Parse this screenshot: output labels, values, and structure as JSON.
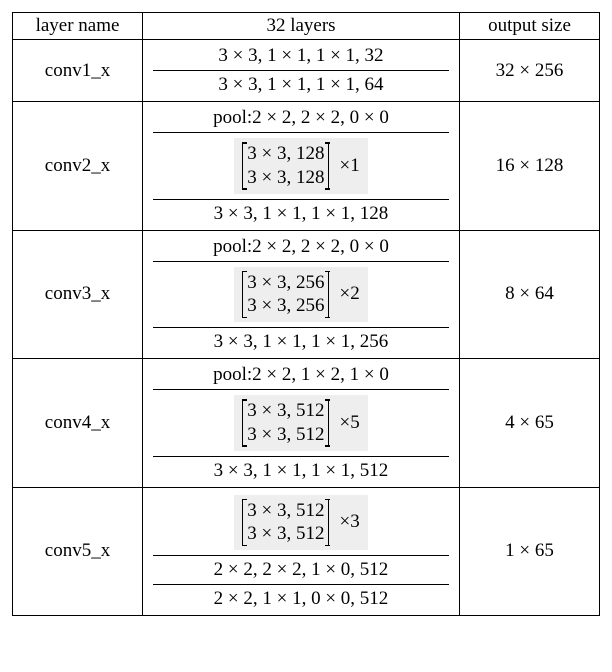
{
  "header": {
    "layer": "layer name",
    "arch": "32 layers",
    "out": "output size"
  },
  "rows": [
    {
      "layer": "conv1_x",
      "lines": [
        "3 × 3, 1 × 1, 1 × 1, 32",
        "3 × 3, 1 × 1, 1 × 1, 64"
      ],
      "out": "32 × 256"
    },
    {
      "layer": "conv2_x",
      "pool": "pool:2 × 2, 2 × 2, 0 × 0",
      "block": {
        "rows": [
          "3 × 3, 128",
          "3 × 3, 128"
        ],
        "mult": "×1"
      },
      "tail": [
        "3 × 3, 1 × 1, 1 × 1, 128"
      ],
      "out": "16 × 128"
    },
    {
      "layer": "conv3_x",
      "pool": "pool:2 × 2, 2 × 2, 0 × 0",
      "block": {
        "rows": [
          "3 × 3, 256",
          "3 × 3, 256"
        ],
        "mult": "×2"
      },
      "tail": [
        "3 × 3, 1 × 1, 1 × 1, 256"
      ],
      "out": "8 × 64"
    },
    {
      "layer": "conv4_x",
      "pool": "pool:2 × 2, 1 × 2, 1 × 0",
      "block": {
        "rows": [
          "3 × 3, 512",
          "3 × 3, 512"
        ],
        "mult": "×5"
      },
      "tail": [
        "3 × 3, 1 × 1, 1 × 1, 512"
      ],
      "out": "4 × 65"
    },
    {
      "layer": "conv5_x",
      "block": {
        "rows": [
          "3 × 3, 512",
          "3 × 3, 512"
        ],
        "mult": "×3"
      },
      "tail": [
        "2 × 2, 2 × 2, 1 × 0, 512",
        "2 × 2, 1 × 1, 0 × 0, 512"
      ],
      "out": "1 × 65"
    }
  ],
  "chart_data": {
    "type": "table",
    "columns": [
      "layer name",
      "32 layers",
      "output size"
    ],
    "rows": [
      [
        "conv1_x",
        "3×3,1×1,1×1,32 ; 3×3,1×1,1×1,64",
        "32×256"
      ],
      [
        "conv2_x",
        "pool:2×2,2×2,0×0 ; [3×3,128;3×3,128]×1 ; 3×3,1×1,1×1,128",
        "16×128"
      ],
      [
        "conv3_x",
        "pool:2×2,2×2,0×0 ; [3×3,256;3×3,256]×2 ; 3×3,1×1,1×1,256",
        "8×64"
      ],
      [
        "conv4_x",
        "pool:2×2,1×2,1×0 ; [3×3,512;3×3,512]×5 ; 3×3,1×1,1×1,512",
        "4×65"
      ],
      [
        "conv5_x",
        "[3×3,512;3×3,512]×3 ; 2×2,2×2,1×0,512 ; 2×2,1×1,0×0,512",
        "1×65"
      ]
    ]
  }
}
